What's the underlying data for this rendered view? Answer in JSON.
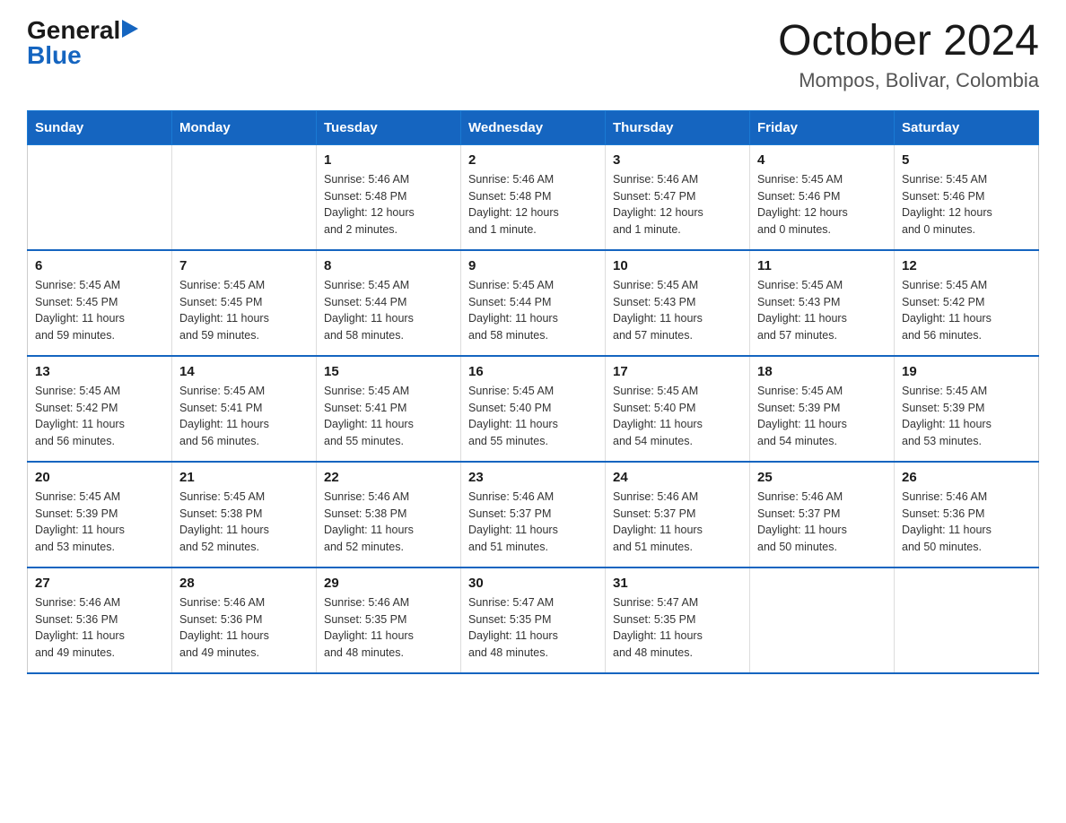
{
  "header": {
    "logo": {
      "general": "General",
      "blue": "Blue",
      "tagline": "GeneralBlue"
    },
    "title": "October 2024",
    "location": "Mompos, Bolivar, Colombia"
  },
  "weekdays": [
    "Sunday",
    "Monday",
    "Tuesday",
    "Wednesday",
    "Thursday",
    "Friday",
    "Saturday"
  ],
  "weeks": [
    [
      {
        "day": "",
        "info": ""
      },
      {
        "day": "",
        "info": ""
      },
      {
        "day": "1",
        "info": "Sunrise: 5:46 AM\nSunset: 5:48 PM\nDaylight: 12 hours\nand 2 minutes."
      },
      {
        "day": "2",
        "info": "Sunrise: 5:46 AM\nSunset: 5:48 PM\nDaylight: 12 hours\nand 1 minute."
      },
      {
        "day": "3",
        "info": "Sunrise: 5:46 AM\nSunset: 5:47 PM\nDaylight: 12 hours\nand 1 minute."
      },
      {
        "day": "4",
        "info": "Sunrise: 5:45 AM\nSunset: 5:46 PM\nDaylight: 12 hours\nand 0 minutes."
      },
      {
        "day": "5",
        "info": "Sunrise: 5:45 AM\nSunset: 5:46 PM\nDaylight: 12 hours\nand 0 minutes."
      }
    ],
    [
      {
        "day": "6",
        "info": "Sunrise: 5:45 AM\nSunset: 5:45 PM\nDaylight: 11 hours\nand 59 minutes."
      },
      {
        "day": "7",
        "info": "Sunrise: 5:45 AM\nSunset: 5:45 PM\nDaylight: 11 hours\nand 59 minutes."
      },
      {
        "day": "8",
        "info": "Sunrise: 5:45 AM\nSunset: 5:44 PM\nDaylight: 11 hours\nand 58 minutes."
      },
      {
        "day": "9",
        "info": "Sunrise: 5:45 AM\nSunset: 5:44 PM\nDaylight: 11 hours\nand 58 minutes."
      },
      {
        "day": "10",
        "info": "Sunrise: 5:45 AM\nSunset: 5:43 PM\nDaylight: 11 hours\nand 57 minutes."
      },
      {
        "day": "11",
        "info": "Sunrise: 5:45 AM\nSunset: 5:43 PM\nDaylight: 11 hours\nand 57 minutes."
      },
      {
        "day": "12",
        "info": "Sunrise: 5:45 AM\nSunset: 5:42 PM\nDaylight: 11 hours\nand 56 minutes."
      }
    ],
    [
      {
        "day": "13",
        "info": "Sunrise: 5:45 AM\nSunset: 5:42 PM\nDaylight: 11 hours\nand 56 minutes."
      },
      {
        "day": "14",
        "info": "Sunrise: 5:45 AM\nSunset: 5:41 PM\nDaylight: 11 hours\nand 56 minutes."
      },
      {
        "day": "15",
        "info": "Sunrise: 5:45 AM\nSunset: 5:41 PM\nDaylight: 11 hours\nand 55 minutes."
      },
      {
        "day": "16",
        "info": "Sunrise: 5:45 AM\nSunset: 5:40 PM\nDaylight: 11 hours\nand 55 minutes."
      },
      {
        "day": "17",
        "info": "Sunrise: 5:45 AM\nSunset: 5:40 PM\nDaylight: 11 hours\nand 54 minutes."
      },
      {
        "day": "18",
        "info": "Sunrise: 5:45 AM\nSunset: 5:39 PM\nDaylight: 11 hours\nand 54 minutes."
      },
      {
        "day": "19",
        "info": "Sunrise: 5:45 AM\nSunset: 5:39 PM\nDaylight: 11 hours\nand 53 minutes."
      }
    ],
    [
      {
        "day": "20",
        "info": "Sunrise: 5:45 AM\nSunset: 5:39 PM\nDaylight: 11 hours\nand 53 minutes."
      },
      {
        "day": "21",
        "info": "Sunrise: 5:45 AM\nSunset: 5:38 PM\nDaylight: 11 hours\nand 52 minutes."
      },
      {
        "day": "22",
        "info": "Sunrise: 5:46 AM\nSunset: 5:38 PM\nDaylight: 11 hours\nand 52 minutes."
      },
      {
        "day": "23",
        "info": "Sunrise: 5:46 AM\nSunset: 5:37 PM\nDaylight: 11 hours\nand 51 minutes."
      },
      {
        "day": "24",
        "info": "Sunrise: 5:46 AM\nSunset: 5:37 PM\nDaylight: 11 hours\nand 51 minutes."
      },
      {
        "day": "25",
        "info": "Sunrise: 5:46 AM\nSunset: 5:37 PM\nDaylight: 11 hours\nand 50 minutes."
      },
      {
        "day": "26",
        "info": "Sunrise: 5:46 AM\nSunset: 5:36 PM\nDaylight: 11 hours\nand 50 minutes."
      }
    ],
    [
      {
        "day": "27",
        "info": "Sunrise: 5:46 AM\nSunset: 5:36 PM\nDaylight: 11 hours\nand 49 minutes."
      },
      {
        "day": "28",
        "info": "Sunrise: 5:46 AM\nSunset: 5:36 PM\nDaylight: 11 hours\nand 49 minutes."
      },
      {
        "day": "29",
        "info": "Sunrise: 5:46 AM\nSunset: 5:35 PM\nDaylight: 11 hours\nand 48 minutes."
      },
      {
        "day": "30",
        "info": "Sunrise: 5:47 AM\nSunset: 5:35 PM\nDaylight: 11 hours\nand 48 minutes."
      },
      {
        "day": "31",
        "info": "Sunrise: 5:47 AM\nSunset: 5:35 PM\nDaylight: 11 hours\nand 48 minutes."
      },
      {
        "day": "",
        "info": ""
      },
      {
        "day": "",
        "info": ""
      }
    ]
  ]
}
